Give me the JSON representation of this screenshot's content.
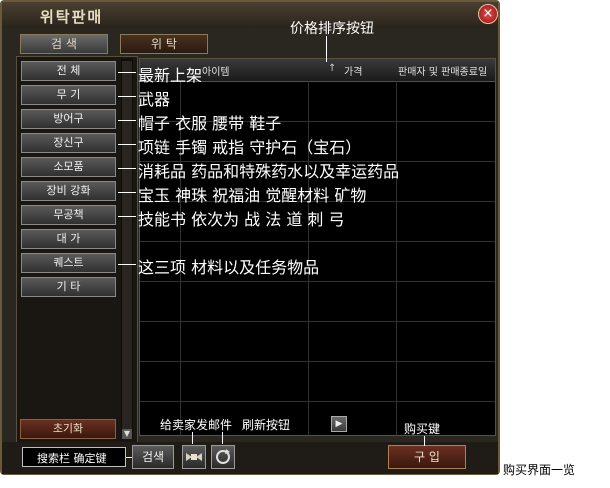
{
  "window": {
    "title": "위탁판매",
    "close_glyph": "×",
    "tabs": [
      {
        "label": "검 색",
        "active": true
      },
      {
        "label": "위 탁",
        "active": false
      }
    ]
  },
  "categories": [
    {
      "label": "전 체"
    },
    {
      "label": "무 기"
    },
    {
      "label": "방어구"
    },
    {
      "label": "장신구"
    },
    {
      "label": "소모품"
    },
    {
      "label": "장비 강화"
    },
    {
      "label": "무공책"
    },
    {
      "label": "대 가"
    },
    {
      "label": "퀘스트"
    },
    {
      "label": "기 타"
    }
  ],
  "reset_label": "초기화",
  "table": {
    "columns": [
      "아이템",
      "가격",
      "판매자 및 판매종료일"
    ]
  },
  "bottom": {
    "search_button": "검색",
    "buy_button": "구 입",
    "next_glyph": "▶"
  },
  "annotations": {
    "sort_button": "价格排序按钮",
    "categories": [
      "最新上架",
      "武器",
      "帽子 衣服 腰带 鞋子",
      "项链 手镯 戒指 守护石（宝石）",
      "消耗品  药品和特殊药水以及幸运药品",
      "宝玉 神珠 祝福油 觉醒材料 矿物",
      "技能书  依次为 战 法 道 刺 弓",
      "这三项 材料以及任务物品"
    ],
    "mail_seller": "给卖家发邮件",
    "refresh": "刷新按钮",
    "buy_key": "购买键",
    "search_bar": "搜索栏 确定键",
    "caption": "购买界面一览"
  },
  "icons": {
    "mail": "mail-wings-icon",
    "refresh": "refresh-icon"
  }
}
